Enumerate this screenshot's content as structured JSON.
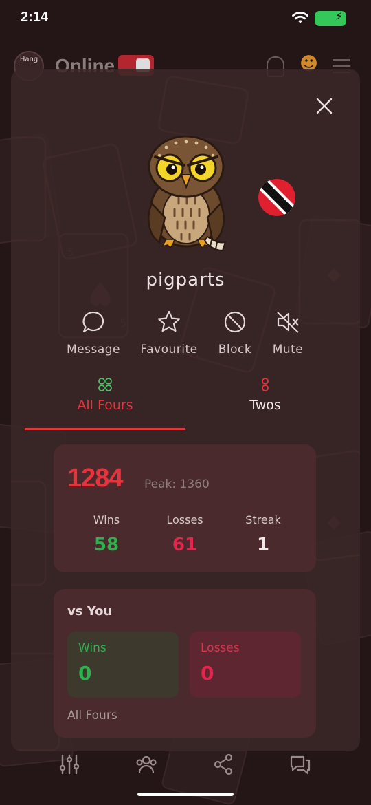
{
  "status_bar": {
    "time": "2:14"
  },
  "app": {
    "logo_text": "Hang",
    "title": "Online"
  },
  "modal": {
    "username": "pigparts",
    "actions": [
      {
        "label": "Message",
        "icon": "chat-bubble-icon"
      },
      {
        "label": "Favourite",
        "icon": "star-icon"
      },
      {
        "label": "Block",
        "icon": "block-icon"
      },
      {
        "label": "Mute",
        "icon": "mute-icon"
      }
    ],
    "tabs": [
      {
        "label": "All Fours",
        "icon": "grid-dots-icon",
        "active": true
      },
      {
        "label": "Twos",
        "icon": "two-dots-icon",
        "active": false
      }
    ],
    "rating": {
      "value": "1284",
      "peak": "Peak: 1360",
      "stats": [
        {
          "label": "Wins",
          "value": "58"
        },
        {
          "label": "Losses",
          "value": "61"
        },
        {
          "label": "Streak",
          "value": "1"
        }
      ]
    },
    "vs_you": {
      "title": "vs You",
      "wins_label": "Wins",
      "wins_value": "0",
      "losses_label": "Losses",
      "losses_value": "0",
      "game": "All Fours"
    }
  },
  "colors": {
    "accent_red": "#e8333d",
    "win_green": "#2fb14f",
    "loss_pink": "#e2264d",
    "modal_bg": "#3a2627"
  }
}
